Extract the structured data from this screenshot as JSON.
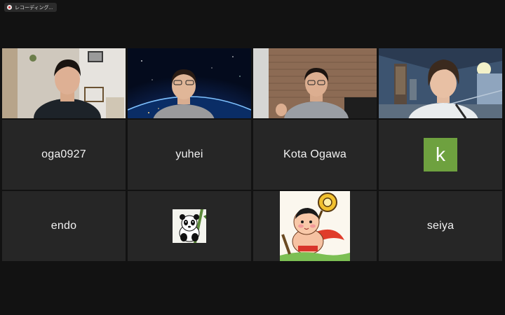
{
  "recording": {
    "label": "レコーディング..."
  },
  "participants": [
    {
      "type": "video",
      "scene": "room-shelf"
    },
    {
      "type": "video",
      "scene": "earth-space"
    },
    {
      "type": "video",
      "scene": "brick-wall"
    },
    {
      "type": "video",
      "scene": "anime-room",
      "active": true
    },
    {
      "type": "name",
      "name": "oga0927"
    },
    {
      "type": "name",
      "name": "yuhei"
    },
    {
      "type": "name",
      "name": "Kota Ogawa"
    },
    {
      "type": "letter",
      "letter": "k",
      "color": "#6ea13f"
    },
    {
      "type": "name",
      "name": "endo"
    },
    {
      "type": "picture",
      "icon": "panda-avatar-icon"
    },
    {
      "type": "picture",
      "icon": "cartoon-character-avatar-icon"
    },
    {
      "type": "name",
      "name": "seiya"
    }
  ],
  "colors": {
    "background": "#121212",
    "tile": "#262626",
    "active_border": "#d6d96a",
    "avatar_green": "#6ea13f"
  }
}
